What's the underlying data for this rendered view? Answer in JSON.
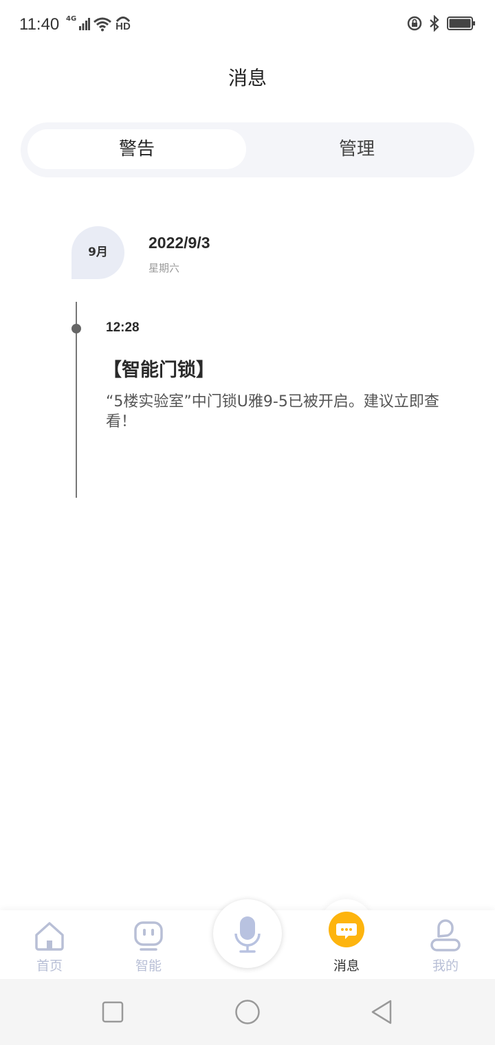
{
  "status_bar": {
    "time": "11:40",
    "network": "4G",
    "hd": "HD",
    "icons": [
      "signal-icon",
      "wifi-icon",
      "hd-call-icon",
      "rotation-lock-icon",
      "bluetooth-icon",
      "battery-icon"
    ]
  },
  "header": {
    "title": "消息"
  },
  "tabs": [
    {
      "label": "警告",
      "active": true
    },
    {
      "label": "管理",
      "active": false
    }
  ],
  "date_group": {
    "month": "9月",
    "date": "2022/9/3",
    "weekday": "星期六"
  },
  "event": {
    "time": "12:28",
    "title": "【智能门锁】",
    "body": "“5楼实验室”中门锁U雅9-5已被开启。建议立即查看！"
  },
  "bottom_nav": {
    "items": [
      {
        "label": "首页",
        "icon": "home-icon",
        "active": false
      },
      {
        "label": "智能",
        "icon": "robot-icon",
        "active": false
      },
      {
        "label": "",
        "icon": "microphone-icon",
        "active": false
      },
      {
        "label": "消息",
        "icon": "message-icon",
        "active": true
      },
      {
        "label": "我的",
        "icon": "user-icon",
        "active": false
      }
    ]
  },
  "colors": {
    "accent": "#fdb40e",
    "inactive_nav": "#b8bfd6",
    "tab_bg": "#f4f5f9",
    "badge_bg": "#e9ecf5"
  },
  "system_nav": {
    "icons": [
      "recent-apps-icon",
      "home-circle-icon",
      "back-icon"
    ]
  }
}
